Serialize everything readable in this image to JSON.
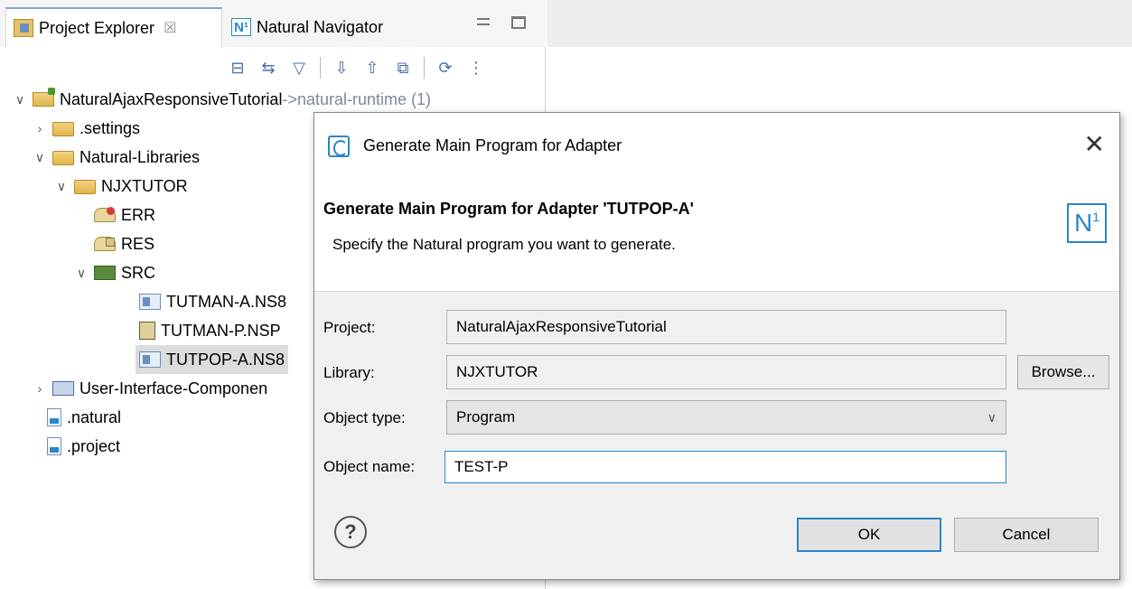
{
  "explorer": {
    "tab_project_explorer": "Project Explorer",
    "tab_close": "☒",
    "tab_natural_navigator": "Natural Navigator",
    "tab_n1": "N¹"
  },
  "tree": {
    "project": "NaturalAjaxResponsiveTutorial",
    "project_suffix": "->natural-runtime (1)",
    "settings": ".settings",
    "natural_libraries": "Natural-Libraries",
    "njxtutor": "NJXTUTOR",
    "err": "ERR",
    "res": "RES",
    "src": "SRC",
    "file1": "TUTMAN-A.NS8",
    "file2": "TUTMAN-P.NSP",
    "file3": "TUTPOP-A.NS8",
    "ui_components": "User-Interface-Componen",
    "natural_file": ".natural",
    "project_file": ".project"
  },
  "dialog": {
    "title": "Generate Main Program for Adapter",
    "close": "✕",
    "header_title": "Generate Main Program for Adapter 'TUTPOP-A'",
    "header_desc": "Specify the Natural program you want to generate.",
    "logo": "N",
    "logo_sup": "1",
    "project_label": "Project:",
    "project_value": "NaturalAjaxResponsiveTutorial",
    "library_label": "Library:",
    "library_value": "NJXTUTOR",
    "browse_label": "Browse...",
    "type_label": "Object type:",
    "type_value": "Program",
    "name_label": "Object name:",
    "name_value": "TEST-P",
    "help": "?",
    "ok_label": "OK",
    "cancel_label": "Cancel"
  }
}
